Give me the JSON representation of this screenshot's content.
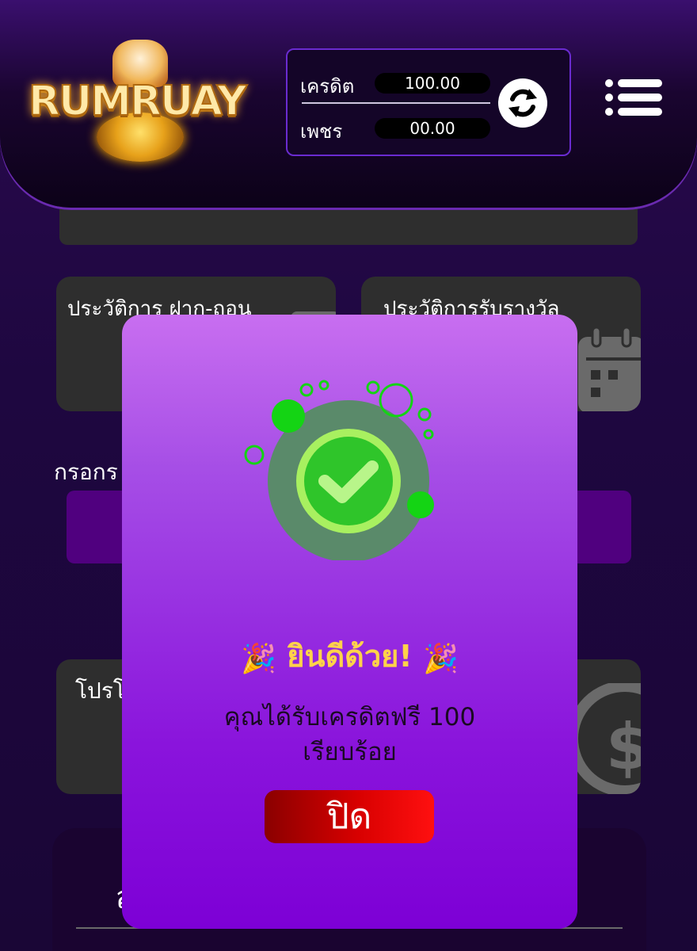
{
  "header": {
    "logo_text": "RUMRUAY",
    "credit_label": "เครดิต",
    "credit_value": "100.00",
    "diamond_label": "เพชร",
    "diamond_value": "00.00"
  },
  "cards": {
    "deposit_withdraw_history": "ประวัติการ ฝาก-ถอน",
    "reward_history": "ประวัติการรับรางวัล",
    "promotion": "โปรโ"
  },
  "form": {
    "label": "กรอกร"
  },
  "bottom_panel": {
    "text": "ส"
  },
  "modal": {
    "title": "ยินดีด้วย!",
    "party_icon": "🎉",
    "message_line1": "คุณได้รับเครดิตฟรี 100",
    "message_line2": "เรียบร้อย",
    "close_label": "ปิด"
  },
  "colors": {
    "modal_top": "#c86ef0",
    "modal_bottom": "#7d00d6",
    "title_yellow": "#ffd24a",
    "close_red": "#d80000",
    "check_green": "#2fc52a"
  }
}
